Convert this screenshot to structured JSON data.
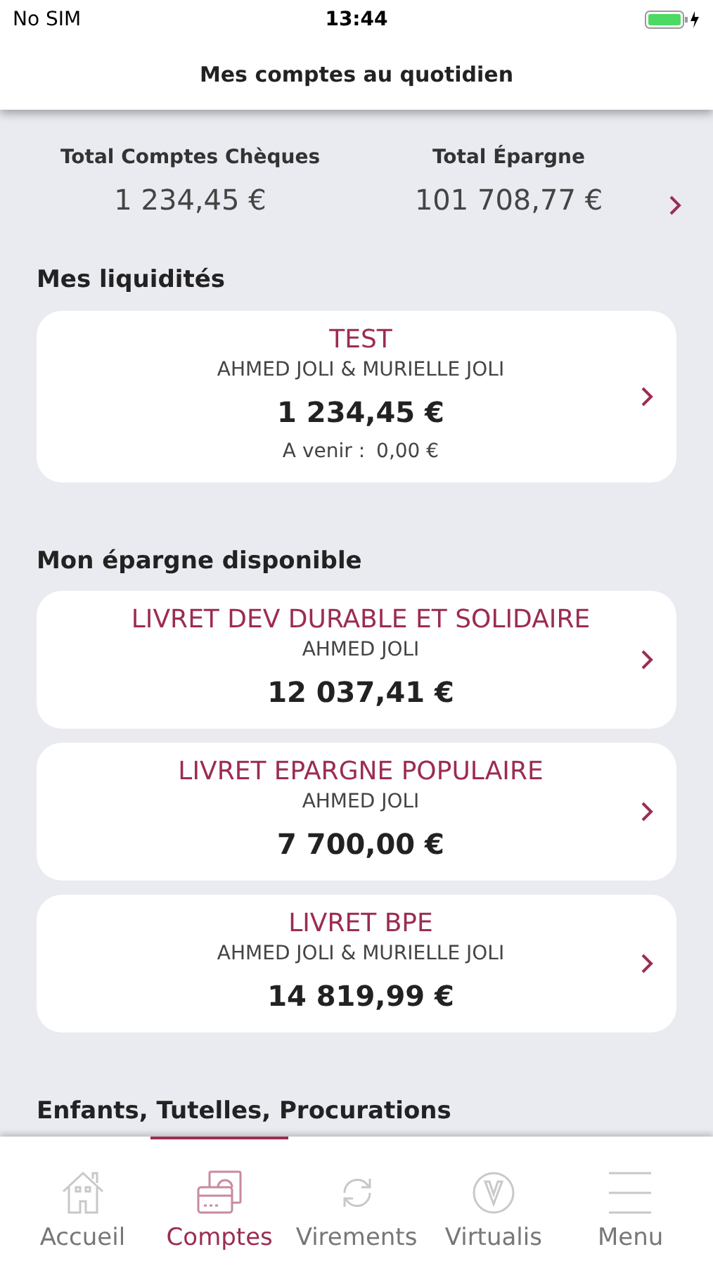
{
  "status_bar": {
    "carrier": "No SIM",
    "time": "13:44"
  },
  "header": {
    "title": "Mes comptes au quotidien"
  },
  "totals": [
    {
      "label": "Total Comptes Chèques",
      "amount": "1 234,45 €"
    },
    {
      "label": "Total Épargne",
      "amount": "101 708,77 €"
    }
  ],
  "sections": [
    {
      "title": "Mes liquidités",
      "accounts": [
        {
          "name": "TEST",
          "holders": "AHMED JOLI & MURIELLE JOLI",
          "balance": "1 234,45 €",
          "upcoming_label": "A venir :",
          "upcoming": "0,00 €"
        }
      ]
    },
    {
      "title": "Mon épargne disponible",
      "accounts": [
        {
          "name": "LIVRET DEV DURABLE ET SOLIDAIRE",
          "holders": "AHMED JOLI",
          "balance": "12 037,41 €"
        },
        {
          "name": "LIVRET EPARGNE POPULAIRE",
          "holders": "AHMED JOLI",
          "balance": "7 700,00 €"
        },
        {
          "name": "LIVRET BPE",
          "holders": "AHMED JOLI & MURIELLE JOLI",
          "balance": "14 819,99 €"
        }
      ]
    },
    {
      "title": "Enfants, Tutelles, Procurations"
    }
  ],
  "tabs": [
    {
      "kind": "home",
      "label": "Accueil",
      "selected": false
    },
    {
      "kind": "accounts",
      "label": "Comptes",
      "selected": true
    },
    {
      "kind": "transfers",
      "label": "Virements",
      "selected": false
    },
    {
      "kind": "virtualis",
      "label": "Virtualis",
      "selected": false
    },
    {
      "kind": "menu",
      "label": "Menu",
      "selected": false
    }
  ]
}
